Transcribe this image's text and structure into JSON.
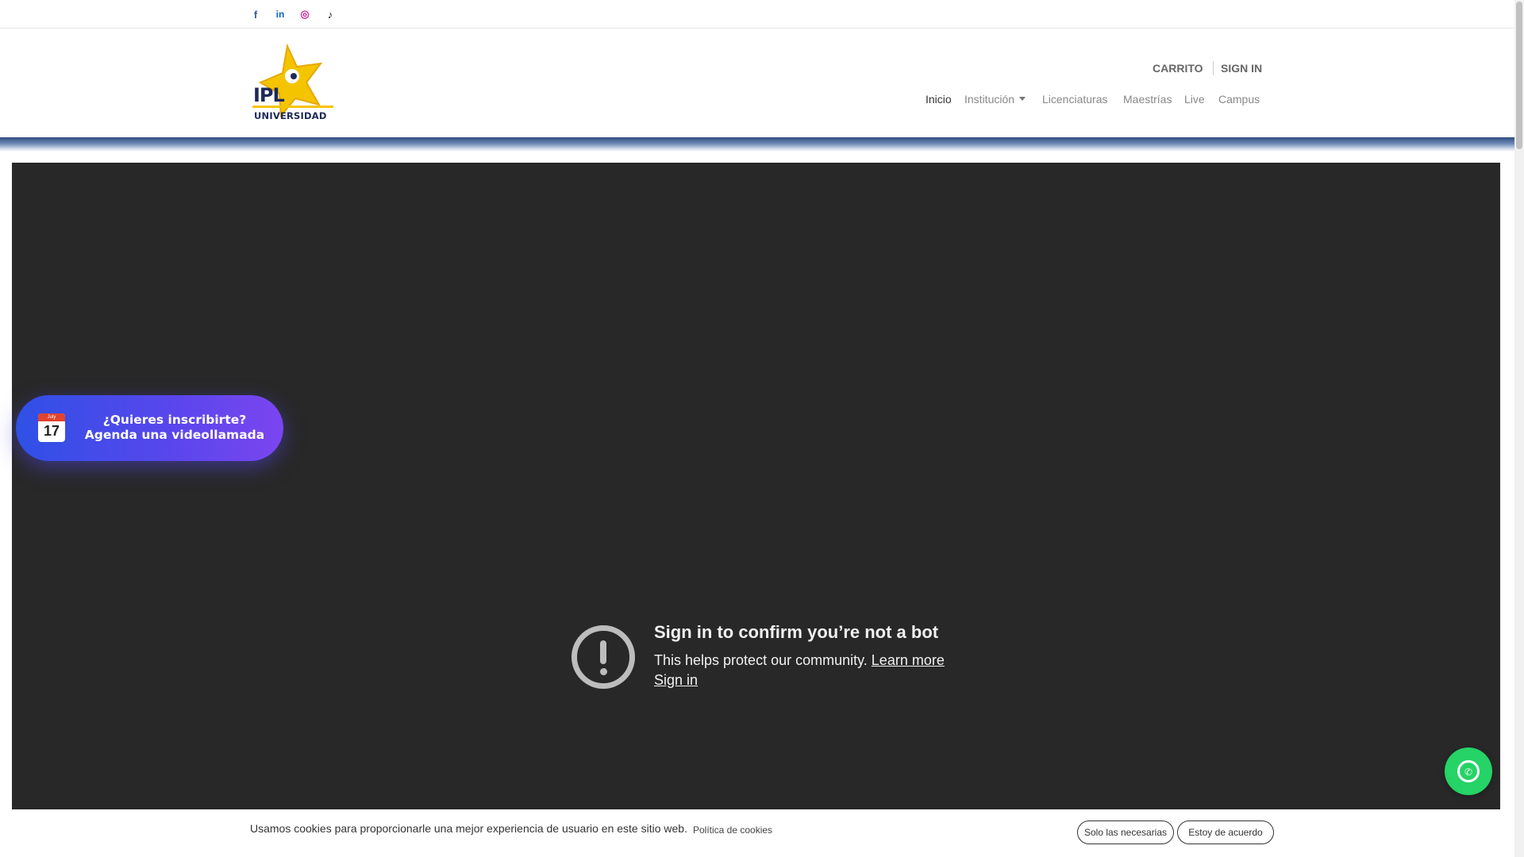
{
  "social": {
    "facebook_icon": "facebook-icon",
    "linkedin_icon": "linkedin-icon",
    "instagram_icon": "instagram-icon",
    "tiktok_icon": "tiktok-icon",
    "facebook_glyph": "f",
    "linkedin_glyph": "in",
    "instagram_glyph": "◎",
    "tiktok_glyph": "♪"
  },
  "brand": {
    "logo_name": "IPL",
    "logo_subtitle": "UNIVERSIDAD",
    "accent_yellow": "#f5c400",
    "navy": "#1d2a57"
  },
  "header": {
    "cart_label": "CARRITO",
    "signin_label": "SIGN IN",
    "nav": [
      {
        "label": "Inicio"
      },
      {
        "label": "Institución"
      },
      {
        "label": "Licenciaturas"
      },
      {
        "label": "Maestrías"
      },
      {
        "label": "Live"
      },
      {
        "label": "Campus"
      }
    ]
  },
  "video": {
    "title": "Sign in to confirm you’re not a bot",
    "text": "This helps protect our community.",
    "learn_more": "Learn more",
    "sign_in": "Sign in",
    "icon": "exclamation-circle-icon"
  },
  "cta": {
    "calendar_month": "July",
    "calendar_day": "17",
    "line1": "¿Quieres inscribirte?",
    "line2": "Agenda una videollamada"
  },
  "whatsapp": {
    "icon": "whatsapp-icon",
    "glyph": "✆",
    "color": "#25d366"
  },
  "cookie": {
    "text": "Usamos cookies para proporcionarle una mejor experiencia de usuario en este sitio web.",
    "policy_link": "Política de cookies",
    "btn_necessary": "Solo las necesarias",
    "btn_accept": "Estoy de acuerdo"
  }
}
